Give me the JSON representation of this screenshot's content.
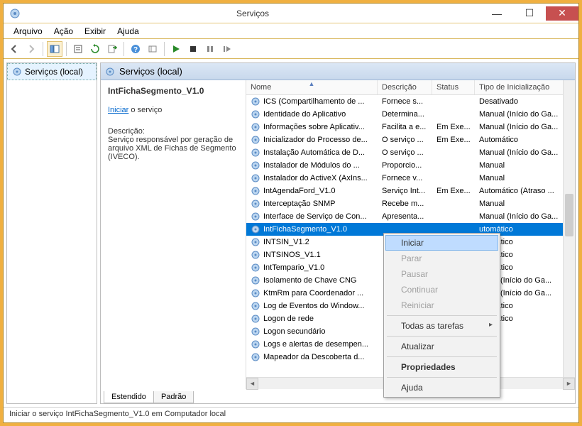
{
  "window": {
    "title": "Serviços"
  },
  "menubar": [
    "Arquivo",
    "Ação",
    "Exibir",
    "Ajuda"
  ],
  "tree": {
    "root": "Serviços (local)"
  },
  "pane_header": "Serviços (local)",
  "detail": {
    "service_name": "IntFichaSegmento_V1.0",
    "action_link": "Iniciar",
    "action_suffix": " o serviço",
    "desc_label": "Descrição:",
    "description": "Serviço responsável por geração de arquivo XML de Fichas de Segmento (IVECO)."
  },
  "columns": {
    "name": "Nome",
    "desc": "Descrição",
    "status": "Status",
    "start": "Tipo de Inicialização"
  },
  "rows": [
    {
      "name": "ICS (Compartilhamento de ...",
      "desc": "Fornece s...",
      "status": "",
      "start": "Desativado"
    },
    {
      "name": "Identidade do Aplicativo",
      "desc": "Determina...",
      "status": "",
      "start": "Manual (Início do Ga..."
    },
    {
      "name": "Informações sobre Aplicativ...",
      "desc": "Facilita a e...",
      "status": "Em Exe...",
      "start": "Manual (Início do Ga..."
    },
    {
      "name": "Inicializador do Processo de...",
      "desc": "O serviço ...",
      "status": "Em Exe...",
      "start": "Automático"
    },
    {
      "name": "Instalação Automática de D...",
      "desc": "O serviço ...",
      "status": "",
      "start": "Manual (Início do Ga..."
    },
    {
      "name": "Instalador de Módulos do ...",
      "desc": "Proporcio...",
      "status": "",
      "start": "Manual"
    },
    {
      "name": "Instalador do ActiveX (AxIns...",
      "desc": "Fornece v...",
      "status": "",
      "start": "Manual"
    },
    {
      "name": "IntAgendaFord_V1.0",
      "desc": "Serviço Int...",
      "status": "Em Exe...",
      "start": "Automático (Atraso ..."
    },
    {
      "name": "Interceptação SNMP",
      "desc": "Recebe m...",
      "status": "",
      "start": "Manual"
    },
    {
      "name": "Interface de Serviço de Con...",
      "desc": "Apresenta...",
      "status": "",
      "start": "Manual (Início do Ga..."
    },
    {
      "name": "IntFichaSegmento_V1.0",
      "desc": "",
      "status": "",
      "start": "utomático",
      "selected": true
    },
    {
      "name": "INTSIN_V1.2",
      "desc": "",
      "status": "",
      "start": "utomático"
    },
    {
      "name": "INTSINOS_V1.1",
      "desc": "",
      "status": "",
      "start": "utomático"
    },
    {
      "name": "IntTempario_V1.0",
      "desc": "",
      "status": "",
      "start": "utomático"
    },
    {
      "name": "Isolamento de Chave CNG",
      "desc": "",
      "status": "",
      "start": "anual (Início do Ga..."
    },
    {
      "name": "KtmRm para Coordenador ...",
      "desc": "",
      "status": "",
      "start": "anual (Início do Ga..."
    },
    {
      "name": "Log de Eventos do Window...",
      "desc": "",
      "status": "",
      "start": "utomático"
    },
    {
      "name": "Logon de rede",
      "desc": "",
      "status": "",
      "start": "utomático"
    },
    {
      "name": "Logon secundário",
      "desc": "",
      "status": "",
      "start": "anual"
    },
    {
      "name": "Logs e alertas de desempen...",
      "desc": "",
      "status": "",
      "start": "anual"
    },
    {
      "name": "Mapeador da Descoberta d...",
      "desc": "",
      "status": "",
      "start": "anual"
    }
  ],
  "context_menu": {
    "iniciar": "Iniciar",
    "parar": "Parar",
    "pausar": "Pausar",
    "continuar": "Continuar",
    "reiniciar": "Reiniciar",
    "todas": "Todas as tarefas",
    "atualizar": "Atualizar",
    "propriedades": "Propriedades",
    "ajuda": "Ajuda"
  },
  "tabs": {
    "estendido": "Estendido",
    "padrao": "Padrão"
  },
  "statusbar": "Iniciar o serviço IntFichaSegmento_V1.0 em Computador local"
}
